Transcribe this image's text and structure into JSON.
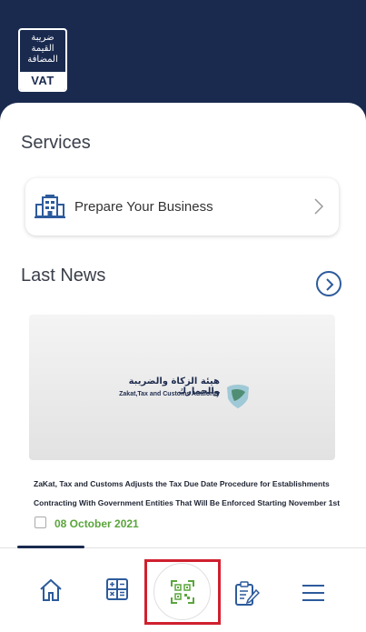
{
  "header": {
    "logo_arabic_lines": [
      "ضريبة",
      "القيمة",
      "المضافة"
    ],
    "logo_band_text": "VAT"
  },
  "services": {
    "title": "Services",
    "items": [
      {
        "label": "Prepare Your Business",
        "icon": "building-icon"
      }
    ]
  },
  "news": {
    "title": "Last News",
    "image": {
      "org_arabic": "هيئة الزكاة والضريبة والجمارك",
      "org_english": "Zakat,Tax and Customs Authority"
    },
    "headline_line1": "ZaKat, Tax and Customs Adjusts the Tax Due Date Procedure for Establishments",
    "headline_line2": "Contracting With Government Entities That Will Be Enforced Starting November 1st",
    "date": "08 October 2021"
  },
  "bottom_nav": {
    "items": [
      {
        "name": "home",
        "icon": "home-icon"
      },
      {
        "name": "calculator",
        "icon": "calculator-icon"
      },
      {
        "name": "qr-scan",
        "icon": "qr-scan-icon"
      },
      {
        "name": "documents",
        "icon": "document-edit-icon"
      },
      {
        "name": "menu",
        "icon": "hamburger-menu-icon"
      }
    ],
    "active_index": 0
  },
  "colors": {
    "brand_navy": "#1a2a4f",
    "accent_blue": "#2d5b9c",
    "date_green": "#5aa53c",
    "highlight_red": "#d0202f"
  }
}
